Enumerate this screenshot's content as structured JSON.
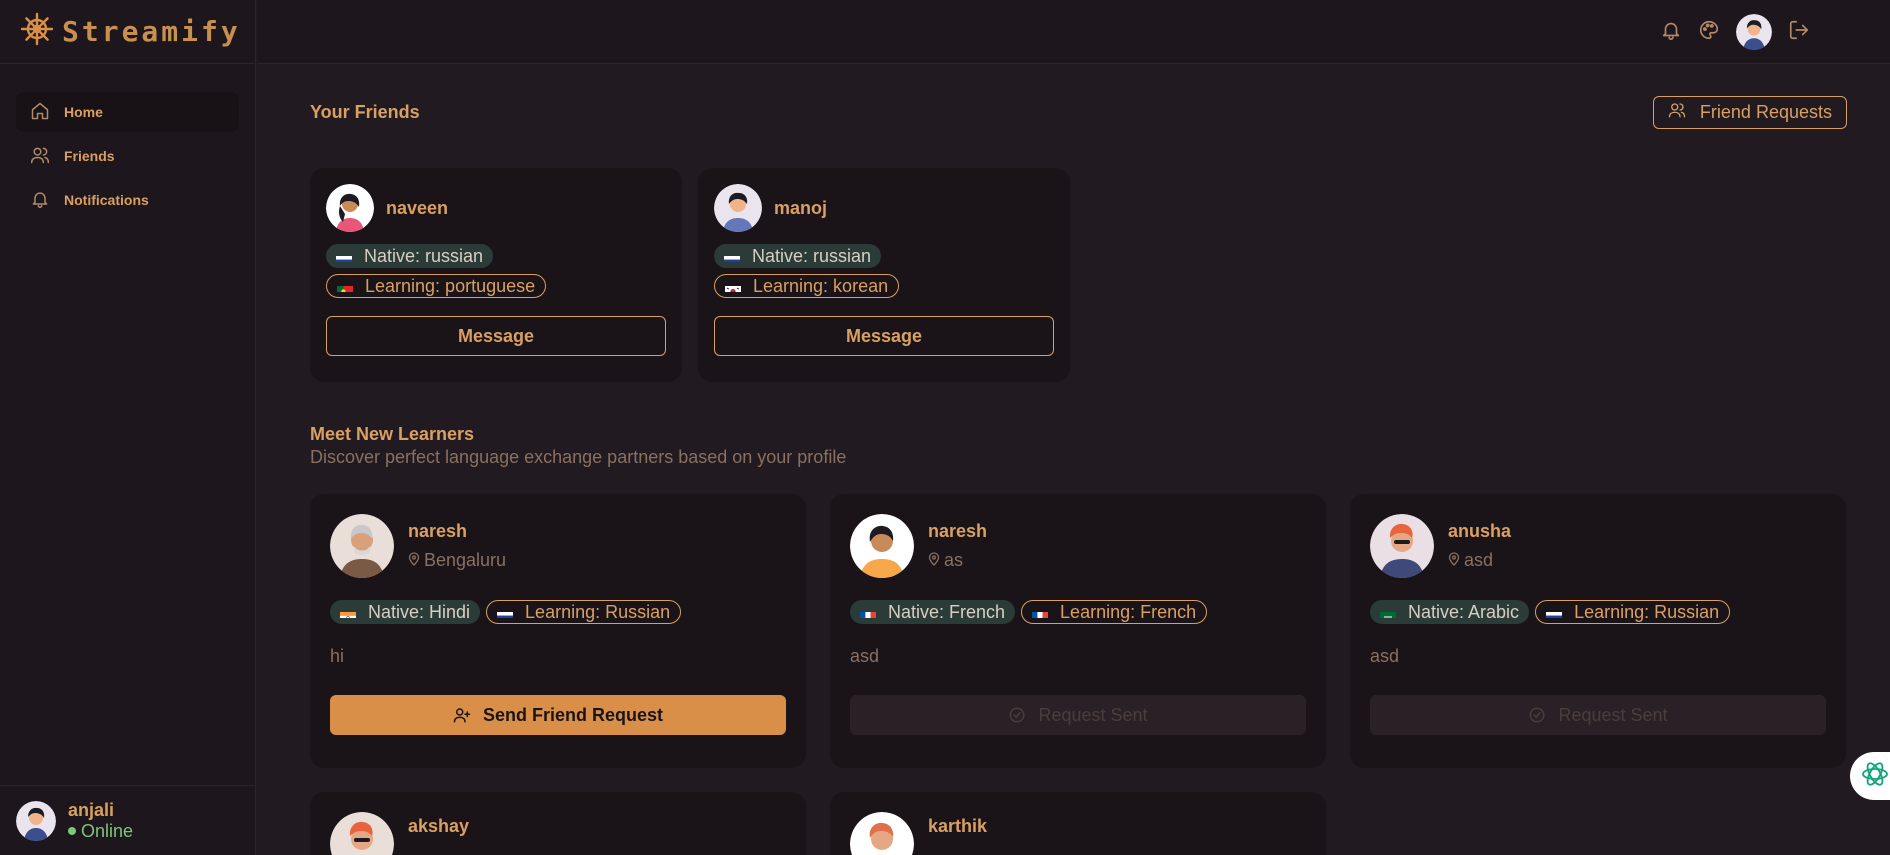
{
  "app": {
    "brand": "Streamify",
    "brand_icon": "ship-wheel-icon"
  },
  "sidebar": {
    "items": [
      {
        "label": "Home",
        "icon": "home-icon",
        "active": true
      },
      {
        "label": "Friends",
        "icon": "users-icon",
        "active": false
      },
      {
        "label": "Notifications",
        "icon": "bell-icon",
        "active": false
      }
    ],
    "user": {
      "name": "anjali",
      "status": "Online"
    }
  },
  "header": {
    "icons": [
      "bell-icon",
      "palette-icon",
      "avatar",
      "logout-icon"
    ]
  },
  "friends": {
    "title": "Your Friends",
    "requests_button": "Friend Requests",
    "cards": [
      {
        "name": "naveen",
        "native": "Native: russian",
        "native_flag": "ru",
        "learning": "Learning: portuguese",
        "learning_flag": "pt",
        "button": "Message"
      },
      {
        "name": "manoj",
        "native": "Native: russian",
        "native_flag": "ru",
        "learning": "Learning: korean",
        "learning_flag": "kr",
        "button": "Message"
      }
    ]
  },
  "learners": {
    "title": "Meet New Learners",
    "subtitle": "Discover perfect language exchange partners based on your profile",
    "cards": [
      {
        "name": "naresh",
        "location": "Bengaluru",
        "native": "Native: Hindi",
        "native_flag": "in",
        "learning": "Learning: Russian",
        "learning_flag": "ru",
        "bio": "hi",
        "button": "Send Friend Request",
        "sent": false
      },
      {
        "name": "naresh",
        "location": "as",
        "native": "Native: French",
        "native_flag": "fr",
        "learning": "Learning: French",
        "learning_flag": "fr",
        "bio": "asd",
        "button": "Request Sent",
        "sent": true
      },
      {
        "name": "anusha",
        "location": "asd",
        "native": "Native: Arabic",
        "native_flag": "sa",
        "learning": "Learning: Russian",
        "learning_flag": "ru",
        "bio": "asd",
        "button": "Request Sent",
        "sent": true
      },
      {
        "name": "akshay"
      },
      {
        "name": "karthik"
      }
    ]
  },
  "colors": {
    "accent": "#d9a062",
    "primary_button": "#d98f48",
    "background": "#221a21",
    "card": "#1a1419",
    "online": "#7ec57a"
  }
}
